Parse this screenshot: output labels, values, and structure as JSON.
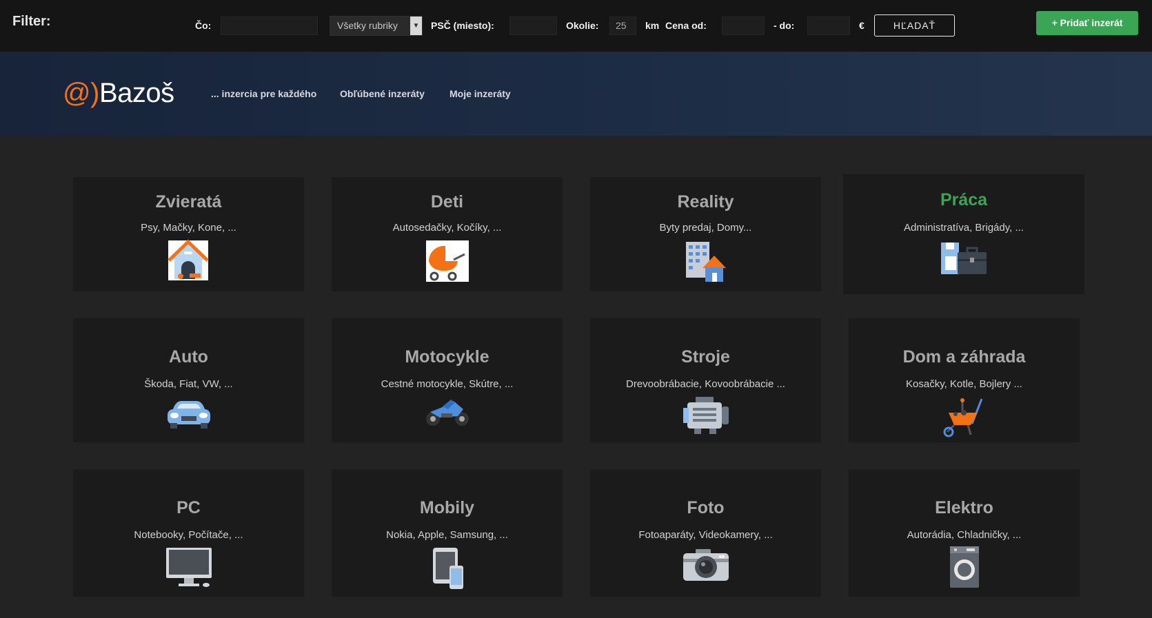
{
  "filter": {
    "title": "Filter:",
    "co_label": "Čo:",
    "co_value": "",
    "category_selected": "Všetky rubriky",
    "psc_label": "PSČ (miesto):",
    "psc_value": "",
    "okolie_label": "Okolie:",
    "okolie_value": "25",
    "km_label": "km",
    "cena_label": "Cena od:",
    "cena_od_value": "",
    "do_label": "- do:",
    "cena_do_value": "",
    "currency": "€",
    "search_label": "HĽADAŤ",
    "add_label": "+ Pridať inzerát"
  },
  "header": {
    "logo_at": "@)",
    "logo_text": "Bazoš",
    "nav": [
      "... inzercia pre každého",
      "Obľúbené inzeráty",
      "Moje inzeráty"
    ]
  },
  "categories": [
    {
      "title": "Zvieratá",
      "sub": "Psy, Mačky, Kone, ...",
      "icon": "doghouse-icon"
    },
    {
      "title": "Deti",
      "sub": "Autosedačky, Kočíky, ...",
      "icon": "stroller-icon"
    },
    {
      "title": "Reality",
      "sub": "Byty predaj, Domy...",
      "icon": "building-house-icon"
    },
    {
      "title": "Práca",
      "sub": "Administratíva, Brigády, ...",
      "icon": "briefcase-icon"
    },
    {
      "title": "Auto",
      "sub": "Škoda, Fiat, VW, ...",
      "icon": "car-icon"
    },
    {
      "title": "Motocykle",
      "sub": "Cestné motocykle, Skútre, ...",
      "icon": "motorcycle-icon"
    },
    {
      "title": "Stroje",
      "sub": "Drevoobrábacie, Kovoobrábacie ...",
      "icon": "machine-icon"
    },
    {
      "title": "Dom a záhrada",
      "sub": "Kosačky, Kotle, Bojlery ...",
      "icon": "wheelbarrow-icon"
    },
    {
      "title": "PC",
      "sub": "Notebooky, Počítače, ...",
      "icon": "monitor-icon"
    },
    {
      "title": "Mobily",
      "sub": "Nokia, Apple, Samsung, ...",
      "icon": "phone-icon"
    },
    {
      "title": "Foto",
      "sub": "Fotoaparáty, Videokamery, ...",
      "icon": "camera-icon"
    },
    {
      "title": "Elektro",
      "sub": "Autorádia, Chladničky, ...",
      "icon": "washing-machine-icon"
    }
  ],
  "colors": {
    "accent_orange": "#f47216",
    "accent_green": "#3aa655",
    "background": "#232323",
    "card": "#1b1b1b"
  }
}
